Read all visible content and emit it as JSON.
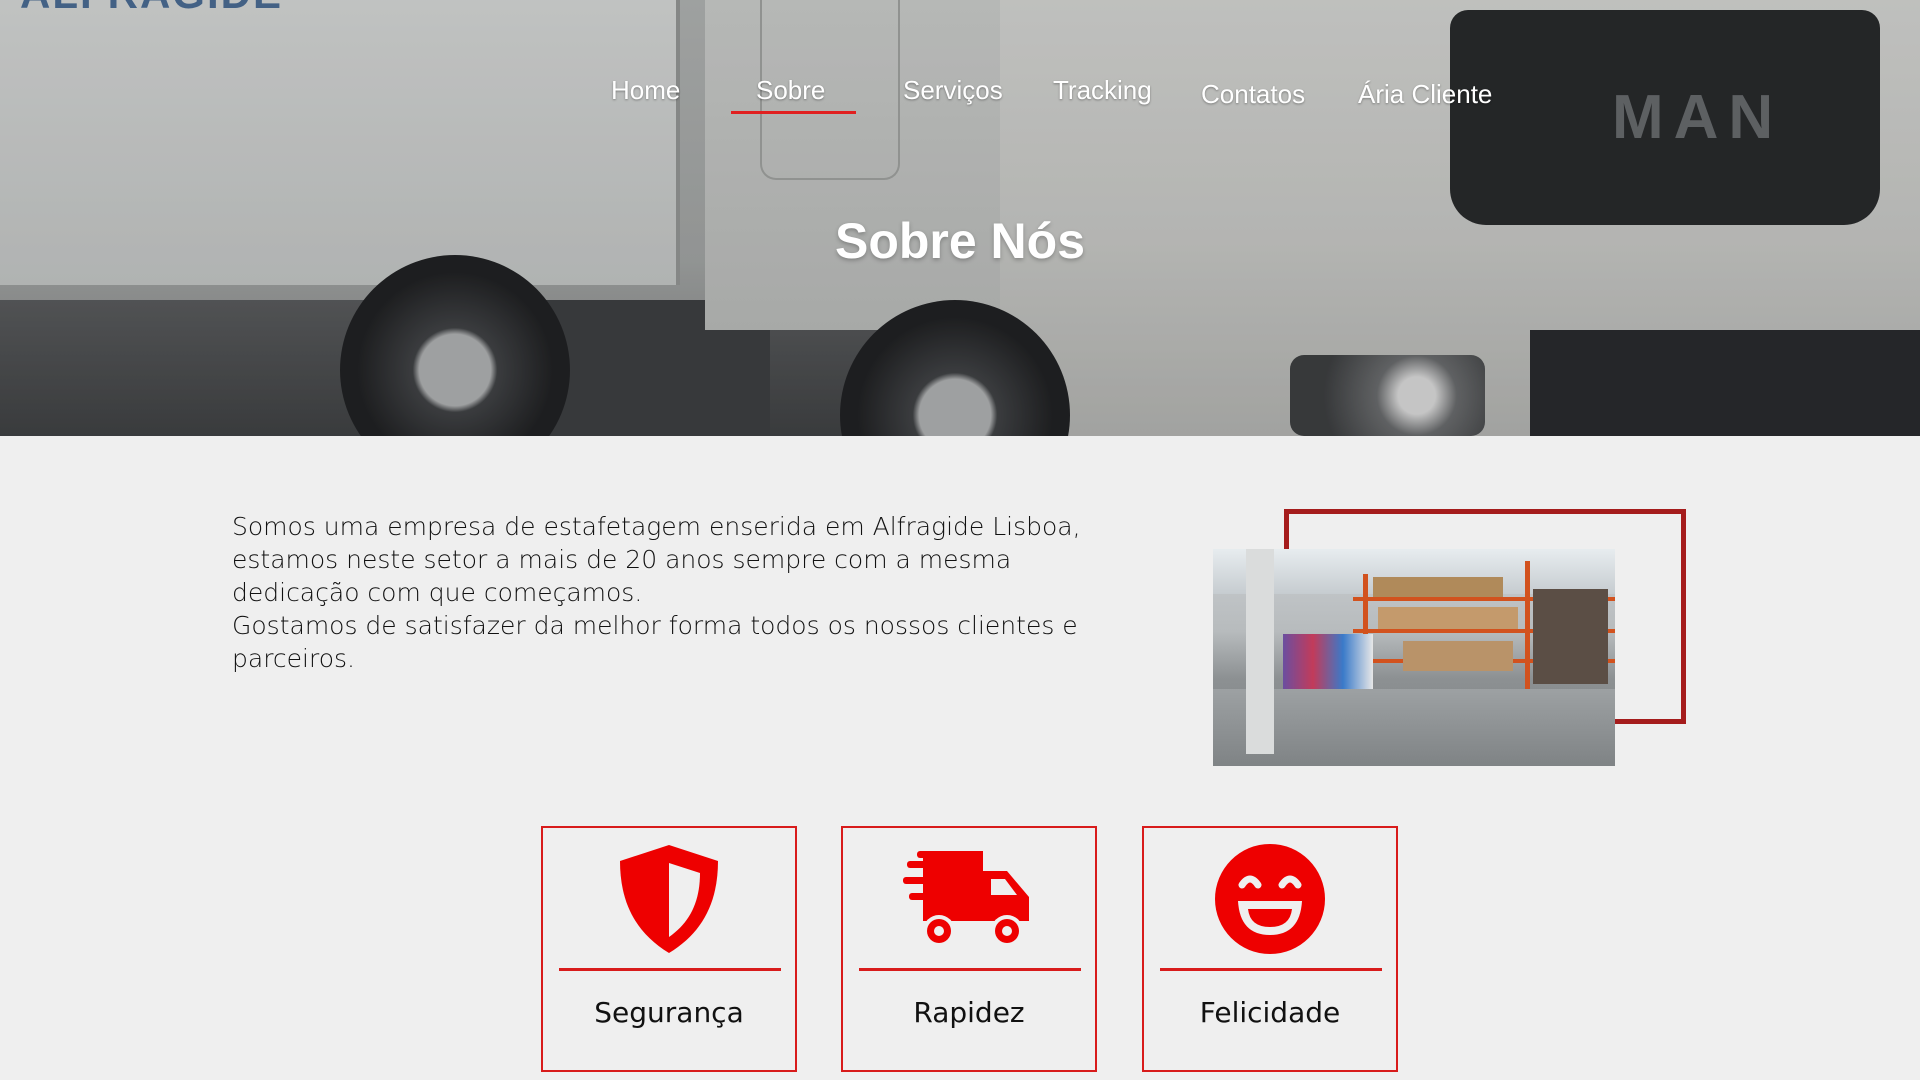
{
  "nav": {
    "items": [
      {
        "label": "Home"
      },
      {
        "label": "Sobre"
      },
      {
        "label": "Serviços"
      },
      {
        "label": "Tracking"
      },
      {
        "label": "Contatos"
      },
      {
        "label": "Ária Cliente"
      }
    ],
    "active": "Sobre"
  },
  "hero": {
    "title": "Sobre Nós",
    "trailer_lettering": "ALFRAGIDE",
    "grille_logo": "MAN"
  },
  "about": {
    "paragraph1": "Somos uma empresa de estafetagem enserida em Alfragide Lisboa, estamos neste setor a mais de 20 anos sempre com a mesma dedicação com que começamos.",
    "paragraph2": "Gostamos de satisfazer da melhor forma todos os nossos clientes e parceiros."
  },
  "features": [
    {
      "label": "Segurança",
      "icon": "shield-icon"
    },
    {
      "label": "Rapidez",
      "icon": "fast-truck-icon"
    },
    {
      "label": "Felicidade",
      "icon": "smile-icon"
    }
  ],
  "colors": {
    "accent": "#d81b1b",
    "frame": "#a51c1c",
    "background": "#efefef",
    "icon_red": "#ee0000"
  }
}
